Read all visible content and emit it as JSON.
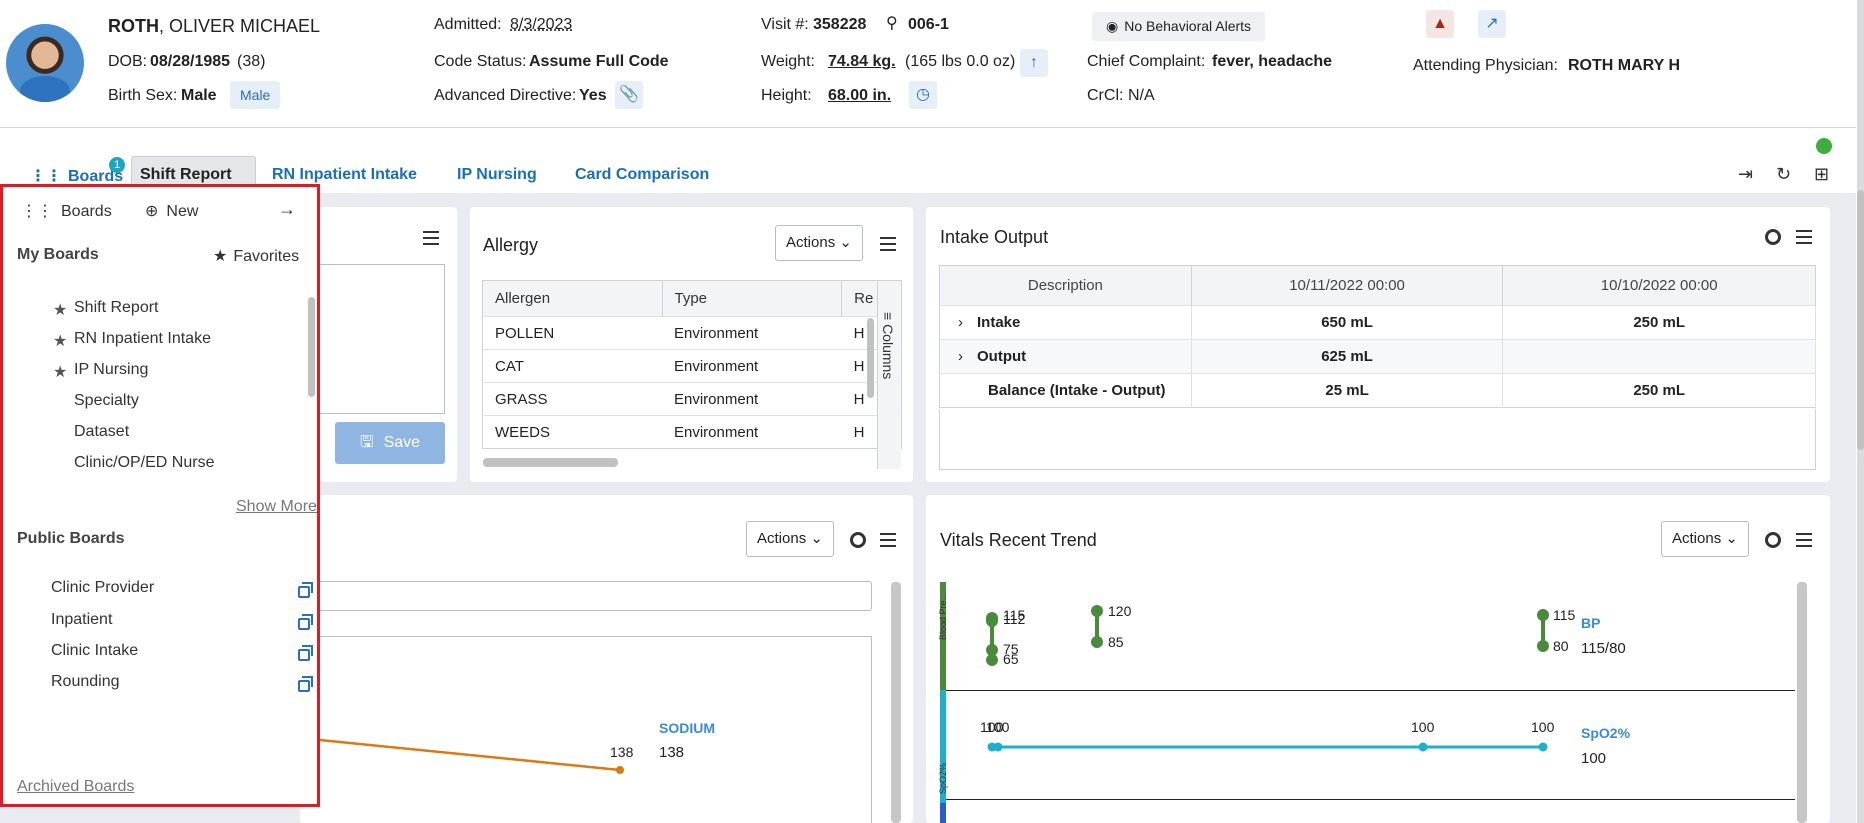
{
  "patient": {
    "last_name": "ROTH",
    "first_names": ", OLIVER MICHAEL",
    "dob_label": "DOB:",
    "dob": "08/28/1985",
    "age": "(38)",
    "birth_sex_label": "Birth Sex:",
    "birth_sex": "Male",
    "gender_chip": "Male",
    "admitted_label": "Admitted:",
    "admitted": "8/3/2023",
    "code_status_label": "Code Status:",
    "code_status": "Assume Full Code",
    "adv_directive_label": "Advanced Directive:",
    "adv_directive": "Yes",
    "visit_label": "Visit #:",
    "visit": "358228",
    "room": "006-1",
    "weight_label": "Weight:",
    "weight": "74.84 kg.",
    "weight_lbs": "(165 lbs 0.0 oz)",
    "height_label": "Height:",
    "height": "68.00 in.",
    "behavioral": "No Behavioral Alerts",
    "complaint_label": "Chief Complaint:",
    "complaint": "fever, headache",
    "crcl_label": "CrCl:",
    "crcl": "N/A",
    "physician_label": "Attending Physician:",
    "physician": "ROTH MARY H"
  },
  "tabs": {
    "boards": "Boards",
    "badge": "1",
    "items": [
      "Shift Report",
      "RN Inpatient Intake",
      "IP Nursing",
      "Card Comparison"
    ]
  },
  "sidebar": {
    "boards": "Boards",
    "new": "New",
    "my_boards": "My Boards",
    "favorites": "Favorites",
    "my_items": [
      "Shift Report",
      "RN Inpatient Intake",
      "IP Nursing",
      "Specialty",
      "Dataset",
      "Clinic/OP/ED Nurse"
    ],
    "show_more": "Show More",
    "public_boards": "Public Boards",
    "public_items": [
      "Clinic Provider",
      "Inpatient",
      "Clinic Intake",
      "Rounding"
    ],
    "archived": "Archived Boards"
  },
  "save_button": "Save",
  "allergy": {
    "title": "Allergy",
    "actions": "Actions",
    "columns_label": "Columns",
    "headers": [
      "Allergen",
      "Type",
      "Re"
    ],
    "rows": [
      [
        "POLLEN",
        "Environment",
        "H"
      ],
      [
        "CAT",
        "Environment",
        "H"
      ],
      [
        "GRASS",
        "Environment",
        "H"
      ],
      [
        "WEEDS",
        "Environment",
        "H"
      ]
    ]
  },
  "intake_output": {
    "title": "Intake Output",
    "headers": [
      "Description",
      "10/11/2022 00:00",
      "10/10/2022 00:00"
    ],
    "rows": [
      {
        "label": "Intake",
        "v1": "650 mL",
        "v2": "250 mL",
        "expand": true
      },
      {
        "label": "Output",
        "v1": "625 mL",
        "v2": "",
        "expand": true
      },
      {
        "label": "Balance (Intake - Output)",
        "v1": "25 mL",
        "v2": "250 mL",
        "expand": false
      }
    ]
  },
  "labs": {
    "actions": "Actions",
    "sodium_label": "SODIUM",
    "sodium_value": "138",
    "sodium_point": "138"
  },
  "vitals": {
    "title": "Vitals Recent Trend",
    "actions": "Actions",
    "bp_axis": "Blood Pre...",
    "spo2_axis": "SpO2%",
    "bp_name": "BP",
    "bp_value": "115/80",
    "spo2_name": "SpO2%",
    "spo2_value": "100",
    "bp_labels": [
      "115",
      "112",
      "75",
      "65",
      "120",
      "85",
      "115",
      "80"
    ],
    "spo2_labels": [
      "100",
      "100",
      "100",
      "100"
    ]
  },
  "colors": {
    "accent": "#1a6fb8",
    "highlight_border": "#e11b22",
    "bp_green": "#4a8a3c",
    "spo2_teal": "#1bb0cc",
    "sodium_orange": "#d97a12",
    "status_green": "#3cae3c"
  }
}
